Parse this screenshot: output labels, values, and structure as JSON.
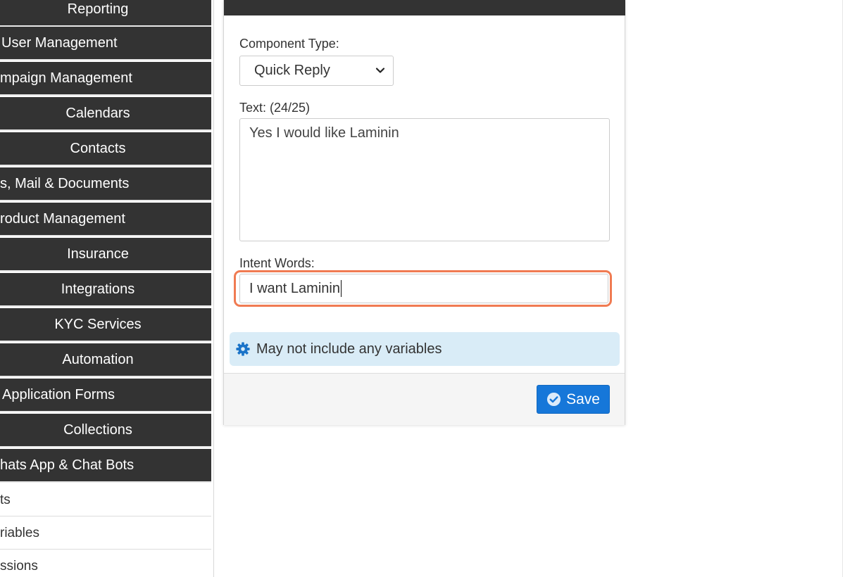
{
  "sidebar": {
    "items": [
      {
        "label": "Reporting"
      },
      {
        "label": "User Management"
      },
      {
        "label": "mpaign Management"
      },
      {
        "label": "Calendars"
      },
      {
        "label": "Contacts"
      },
      {
        "label": "s, Mail & Documents"
      },
      {
        "label": "roduct Management"
      },
      {
        "label": "Insurance"
      },
      {
        "label": "Integrations"
      },
      {
        "label": "KYC Services"
      },
      {
        "label": "Automation"
      },
      {
        "label": "Application Forms"
      },
      {
        "label": "Collections"
      },
      {
        "label": "hats App & Chat Bots"
      }
    ],
    "subitems": [
      {
        "label": "ts"
      },
      {
        "label": "riables"
      },
      {
        "label": "ssions"
      }
    ]
  },
  "panel": {
    "component_type_label": "Component Type:",
    "component_type_value": "Quick Reply",
    "text_label": "Text: (24/25)",
    "text_value": "Yes I would like Laminin",
    "intent_label": "Intent Words:",
    "intent_value": "I want Laminin",
    "info_text": "May not include any variables",
    "save_label": "Save"
  },
  "icons": {
    "select_chevron": "chevron-down-icon",
    "info": "gear-icon",
    "save": "check-circle-icon"
  },
  "colors": {
    "sidebar_bg": "#333333",
    "accent_blue": "#1677d9",
    "focus_ring": "#f07b52",
    "info_bg": "#d9ecf7"
  }
}
